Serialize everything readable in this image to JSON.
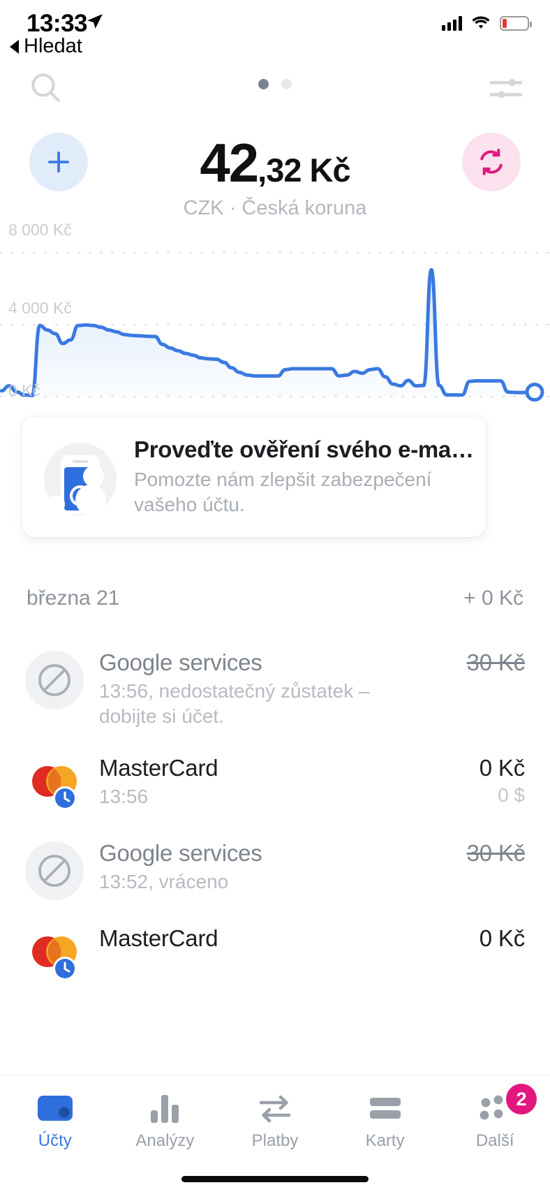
{
  "status_bar": {
    "time": "13:33",
    "location_icon": "location-arrow-icon",
    "signal_icon": "cellular-signal-icon",
    "wifi_icon": "wifi-icon",
    "battery_icon": "battery-low-icon",
    "back_label": "Hledat"
  },
  "toolbar": {
    "search_icon": "search-icon",
    "filter_icon": "sliders-icon",
    "page_dots": 2,
    "active_dot": 0
  },
  "header": {
    "add_icon": "plus-icon",
    "exchange_icon": "refresh-exchange-icon",
    "balance_integer": "42",
    "balance_fraction": ",32 Kč",
    "currency_line": "CZK · Česká koruna",
    "accent_blue": "#3a7ae0",
    "accent_pink": "#e2177e"
  },
  "chart_data": {
    "type": "area",
    "title": "",
    "xlabel": "",
    "ylabel": "",
    "ylim": [
      0,
      9000
    ],
    "ytick_labels": [
      "8 000 Kč",
      "4 000 Kč",
      "0 Kč"
    ],
    "ytick_values": [
      8000,
      4000,
      0
    ],
    "grid": true,
    "line_color": "#3a7ae0",
    "fill_color": "#dbe7f9",
    "end_marker": true,
    "x": [
      0,
      1,
      2,
      3,
      4,
      5,
      6,
      7,
      8,
      9,
      10,
      11,
      12,
      13,
      14,
      15,
      16,
      17,
      18,
      19,
      20,
      21,
      22,
      23,
      24,
      25,
      26,
      27,
      28,
      29,
      30,
      31,
      32,
      33,
      34,
      35,
      36,
      37,
      38,
      39,
      40,
      41,
      42,
      43,
      44,
      45,
      46,
      47,
      48,
      49,
      50,
      51,
      52,
      53,
      54,
      55,
      56,
      57,
      58,
      59,
      60,
      61,
      62,
      63,
      64,
      65,
      66,
      67,
      68,
      69,
      70
    ],
    "values": [
      320,
      600,
      260,
      90,
      60,
      3950,
      3700,
      3500,
      2950,
      3150,
      3950,
      3980,
      3950,
      3850,
      3700,
      3600,
      3450,
      3400,
      3380,
      3350,
      3340,
      2900,
      2700,
      2550,
      2400,
      2300,
      2150,
      2100,
      2080,
      1900,
      1600,
      1350,
      1200,
      1150,
      1150,
      1150,
      1150,
      1500,
      1550,
      1550,
      1550,
      1550,
      1550,
      1550,
      1150,
      1200,
      1400,
      1300,
      1500,
      1550,
      1100,
      700,
      600,
      900,
      600,
      620,
      7050,
      620,
      100,
      90,
      90,
      850,
      880,
      880,
      880,
      880,
      250,
      230,
      230,
      230,
      250
    ]
  },
  "promo_card": {
    "illustration_icon": "phone-person-verify-icon",
    "title": "Proveďte ověření svého e-ma…",
    "subtitle": "Pomozte nám zlepšit zabezpečení vašeho účtu."
  },
  "date_header": {
    "date": "března 21",
    "total": "+ 0 Kč"
  },
  "transactions": [
    {
      "icon": "declined-circle-slash-icon",
      "title": "Google services",
      "title_style": "muted",
      "subtitle": "13:56, nedostatečný zůstatek – dobijte si účet.",
      "amount": "30 Kč",
      "amount_style": "struck",
      "amount_secondary": ""
    },
    {
      "icon": "mastercard-pending-icon",
      "title": "MasterCard",
      "title_style": "dark",
      "subtitle": "13:56",
      "amount": "0 Kč",
      "amount_style": "dark",
      "amount_secondary": "0 $"
    },
    {
      "icon": "declined-circle-slash-icon",
      "title": "Google services",
      "title_style": "muted",
      "subtitle": "13:52, vráceno",
      "amount": "30 Kč",
      "amount_style": "struck",
      "amount_secondary": ""
    },
    {
      "icon": "mastercard-pending-icon",
      "title": "MasterCard",
      "title_style": "dark",
      "subtitle": "",
      "amount": "0 Kč",
      "amount_style": "dark",
      "amount_secondary": ""
    }
  ],
  "tabbar": {
    "items": [
      {
        "icon": "wallet-icon",
        "label": "Účty",
        "active": true,
        "badge": ""
      },
      {
        "icon": "bar-chart-icon",
        "label": "Analýzy",
        "active": false,
        "badge": ""
      },
      {
        "icon": "transfer-arrows-icon",
        "label": "Platby",
        "active": false,
        "badge": ""
      },
      {
        "icon": "credit-card-icon",
        "label": "Karty",
        "active": false,
        "badge": ""
      },
      {
        "icon": "more-dots-icon",
        "label": "Další",
        "active": false,
        "badge": "2"
      }
    ]
  }
}
